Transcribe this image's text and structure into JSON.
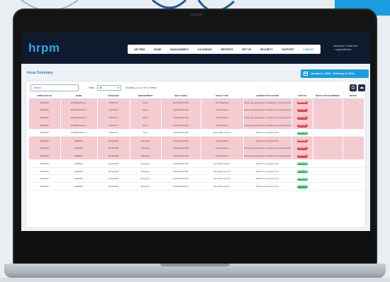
{
  "app": {
    "logo": "hrpm",
    "nav": [
      "HR FIRM",
      "HOME",
      "MANAGEMENT",
      "CALENDAR",
      "REPORTS",
      "SET UP",
      "SECURITY",
      "SUPPORT",
      "LOGOUT"
    ],
    "active_nav": "LOGOUT",
    "user_lines": [
      "Username / Email here",
      "⌂ support@hrpm"
    ]
  },
  "page": {
    "title": "Issue Summary",
    "date_range": "January 1, 2024 - February 3, 2024"
  },
  "filters": {
    "search_placeholder": "Search...",
    "filter_label": "Filter:",
    "filter_value": "All",
    "info_text": "Showing 1 to 12 of 12 entries"
  },
  "table": {
    "columns": [
      "EMPLOYEE ID",
      "NAME",
      "MANAGER",
      "DEPARTMENT",
      "SHIFT DATE",
      "ISSUE TYPE",
      "CORRECTIVE ACTION",
      "STATUS",
      "RESOLUTION NUMBER",
      "NOTES"
    ],
    "rows": [
      {
        "id": "0000000",
        "name": "FITZGERALD H.",
        "manager": "DAVIS M.",
        "dept": "Floor",
        "date": "01/01/2024 8:00",
        "issue": "No Timesheet",
        "action": "Admin has generated a Timesheet | Timesheet Pending",
        "status": "PENDING",
        "tone": "flag",
        "badge": "red"
      },
      {
        "id": "0000000",
        "name": "FITZGERALD H.",
        "manager": "DAVIS M.",
        "dept": "Floor",
        "date": "01/01/2024 8:00",
        "issue": "No Timesheet",
        "action": "Admin has generated a Timesheet | Timesheet Pending",
        "status": "PENDING",
        "tone": "flag",
        "badge": "red"
      },
      {
        "id": "0000000",
        "name": "FITZGERALD H.",
        "manager": "DAVIS M.",
        "dept": "Floor",
        "date": "01/01/2024 8:00",
        "issue": "No Timesheet",
        "action": "Admin has generated a Timesheet | Timesheet Pending",
        "status": "PENDING",
        "tone": "flag",
        "badge": "red"
      },
      {
        "id": "0000000",
        "name": "FITZGERALD H.",
        "manager": "DAVIS M.",
        "dept": "Floor",
        "date": "01/01/2024 8:00",
        "issue": "No Timesheet",
        "action": "Admin has generated a Timesheet | Timesheet Pending",
        "status": "PENDING",
        "tone": "flag",
        "badge": "red"
      },
      {
        "id": "0000000",
        "name": "FITZGERALD H.",
        "manager": "DAVIS M.",
        "dept": "Floor",
        "date": "01/01/2024 8:00",
        "issue": "Early Shift Clock In",
        "action": "Shift Time | Payout Time",
        "status": "APPROVED",
        "tone": "ok",
        "badge": "green"
      },
      {
        "id": "0000000",
        "name": "LEBRON",
        "manager": "JOHNSON",
        "dept": "Business",
        "date": "01/01/2024 8:00",
        "issue": "No Timesheet",
        "action": "Shift Time | Payout Time",
        "status": "PENDING",
        "tone": "flag",
        "badge": "red"
      },
      {
        "id": "0000000",
        "name": "LEBRON",
        "manager": "JOHNSON",
        "dept": "Business",
        "date": "01/01/2024 8:00",
        "issue": "No Timesheet",
        "action": "Admin has generated a Timesheet | Timesheet Pending",
        "status": "PENDING",
        "tone": "flag",
        "badge": "red"
      },
      {
        "id": "0000000",
        "name": "LEBRON",
        "manager": "JOHNSON",
        "dept": "Business",
        "date": "01/01/2024 8:00",
        "issue": "No Timesheet",
        "action": "Admin has generated a Timesheet | Timesheet Pending",
        "status": "PENDING",
        "tone": "flag",
        "badge": "red"
      },
      {
        "id": "0000000",
        "name": "LEBRON",
        "manager": "JOHNSON",
        "dept": "Business",
        "date": "01/01/2024 8:00",
        "issue": "Late Shift Clock In",
        "action": "Shift Time | Payout Time",
        "status": "APPROVED",
        "tone": "ok",
        "badge": "green"
      },
      {
        "id": "0000000",
        "name": "LEBRON",
        "manager": "JOHNSON",
        "dept": "Business",
        "date": "01/01/2024 8:00",
        "issue": "Late Shift Clock In",
        "action": "Shift Time | Payout Time",
        "status": "APPROVED",
        "tone": "ok",
        "badge": "green"
      },
      {
        "id": "0000000",
        "name": "LEBRON",
        "manager": "JOHNSON",
        "dept": "Business",
        "date": "01/01/2024 8:00",
        "issue": "Late Shift Clock In",
        "action": "Shift Time | Payout Time",
        "status": "APPROVED",
        "tone": "ok",
        "badge": "green"
      },
      {
        "id": "0000000",
        "name": "LEBRON",
        "manager": "JOHNSON",
        "dept": "Business",
        "date": "01/01/2024 8:00",
        "issue": "Late Shift Clock In",
        "action": "Shift Time | Payout Time",
        "status": "APPROVED",
        "tone": "ok",
        "badge": "green"
      }
    ]
  },
  "colors": {
    "brand": "#1a9de0",
    "header": "#0f1a2e",
    "flag_row": "#f4cbd0",
    "pending": "#e2434f",
    "approved": "#20b45a"
  }
}
